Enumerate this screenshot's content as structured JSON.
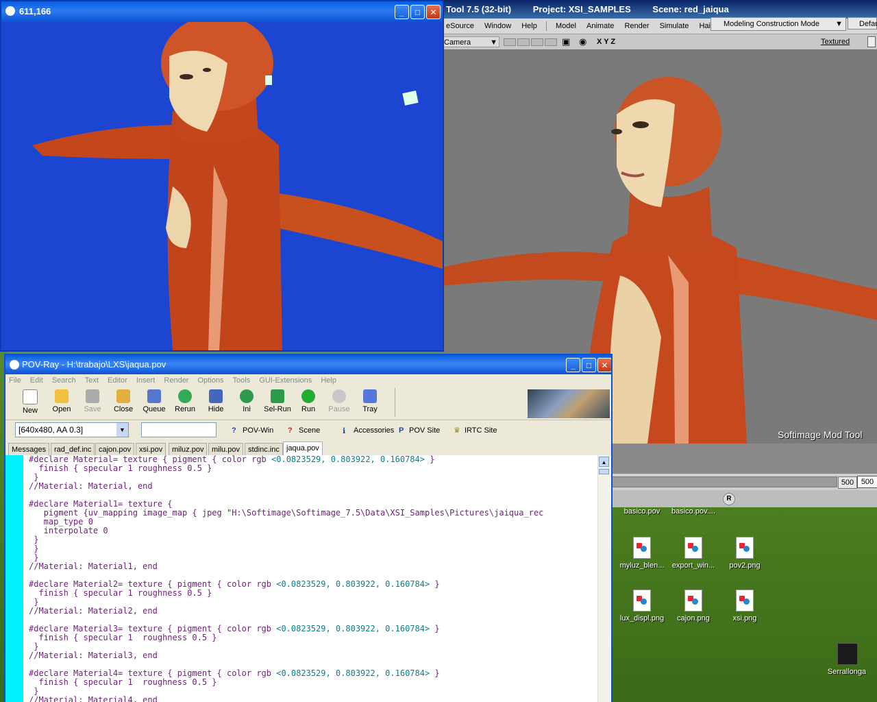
{
  "xsi": {
    "title_app": "Tool 7.5 (32-bit)",
    "title_project": "Project: XSI_SAMPLES",
    "title_scene": "Scene: red_jaiqua",
    "menu": [
      "eSource",
      "Window",
      "Help"
    ],
    "menu2": [
      "Model",
      "Animate",
      "Render",
      "Simulate",
      "Hair"
    ],
    "mode": "Modeling Construction Mode",
    "default": "Defau",
    "camera": "Camera",
    "xyz": "X Y Z",
    "textured": "Textured",
    "watermark": "Softimage  Mod  Tool",
    "frame_a": "500",
    "frame_b": "500",
    "r_label": "R"
  },
  "render": {
    "title": "611,166"
  },
  "pov": {
    "title": "POV-Ray - H:\\trabajo\\LXS\\jaqua.pov",
    "menu": [
      "File",
      "Edit",
      "Search",
      "Text",
      "Editor",
      "Insert",
      "Render",
      "Options",
      "Tools",
      "GUI-Extensions",
      "Help"
    ],
    "toolbar": [
      {
        "label": "New",
        "enabled": true
      },
      {
        "label": "Open",
        "enabled": true
      },
      {
        "label": "Save",
        "enabled": false
      },
      {
        "label": "Close",
        "enabled": true
      },
      {
        "label": "Queue",
        "enabled": true
      },
      {
        "label": "Rerun",
        "enabled": true
      },
      {
        "label": "Hide",
        "enabled": true
      },
      {
        "label": "Ini",
        "enabled": true
      },
      {
        "label": "Sel-Run",
        "enabled": true
      },
      {
        "label": "Run",
        "enabled": true
      },
      {
        "label": "Pause",
        "enabled": false
      },
      {
        "label": "Tray",
        "enabled": true
      }
    ],
    "resolution": "[640x480, AA 0.3]",
    "links": [
      "POV-Win",
      "Scene",
      "Accessories",
      "POV Site",
      "IRTC Site"
    ],
    "tabs": [
      "Messages",
      "rad_def.inc",
      "cajon.pov",
      "xsi.pov",
      "miluz.pov",
      "milu.pov",
      "stdinc.inc",
      "jaqua.pov"
    ],
    "active_tab": "jaqua.pov",
    "code": [
      "#declare Material= texture { pigment { color rgb <0.0823529, 0.803922, 0.160784> }",
      "  finish { specular 1 roughness 0.5 }",
      " }",
      "//Material: Material, end",
      "",
      "#declare Material1= texture {",
      "   pigment {uv_mapping image_map { jpeg \"H:\\Softimage\\Softimage_7.5\\Data\\XSI_Samples\\Pictures\\jaiqua_rec",
      "   map_type 0",
      "   interpolate 0",
      " }",
      " }",
      " }",
      "//Material: Material1, end",
      "",
      "#declare Material2= texture { pigment { color rgb <0.0823529, 0.803922, 0.160784> }",
      "  finish { specular 1 roughness 0.5 }",
      " }",
      "//Material: Material2, end",
      "",
      "#declare Material3= texture { pigment { color rgb <0.0823529, 0.803922, 0.160784> }",
      "  finish { specular 1  roughness 0.5 }",
      " }",
      "//Material: Material3, end",
      "",
      "#declare Material4= texture { pigment { color rgb <0.0823529, 0.803922, 0.160784> }",
      "  finish { specular 1  roughness 0.5 }",
      " }",
      "//Material: Material4, end"
    ]
  },
  "desktop": {
    "icons_top": [
      "basico.pov",
      "basico.pov...."
    ],
    "icons_row1": [
      "myluz_blen...",
      "export_win...",
      "pov2.png"
    ],
    "icons_row2": [
      "lux_displ.png",
      "cajon.png",
      "xsi.png"
    ],
    "shortcut": "Serrallonga"
  },
  "colors": {
    "render_bg": "#1c45d2",
    "viewport_bg": "#7a7a7a",
    "code_purple": "#6f1f7a",
    "code_teal": "#0a7f8a",
    "gutter": "#00f0ff"
  }
}
